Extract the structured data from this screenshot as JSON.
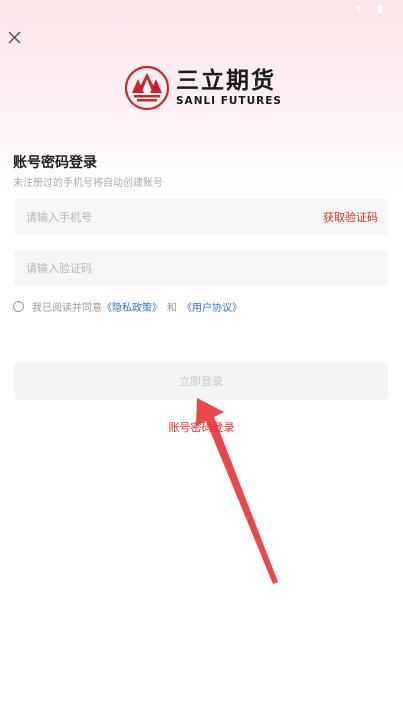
{
  "brand": {
    "name_cn": "三立期货",
    "name_en": "SANLI FUTURES",
    "accent_color": "#d9302f"
  },
  "header": {
    "close_icon": "close-icon"
  },
  "login": {
    "title": "账号密码登录",
    "subtitle": "未注册过的手机号将自动创建账号",
    "phone_placeholder": "请输入手机号",
    "get_code_label": "获取验证码",
    "code_placeholder": "请输入验证码",
    "agreement": {
      "prefix": "我已阅读并同意",
      "privacy_link": "《隐私政策》",
      "conjunction": "和",
      "terms_link": "《用户协议》",
      "checked": false
    },
    "submit_label": "立即登录",
    "switch_label": "账号密码登录"
  }
}
